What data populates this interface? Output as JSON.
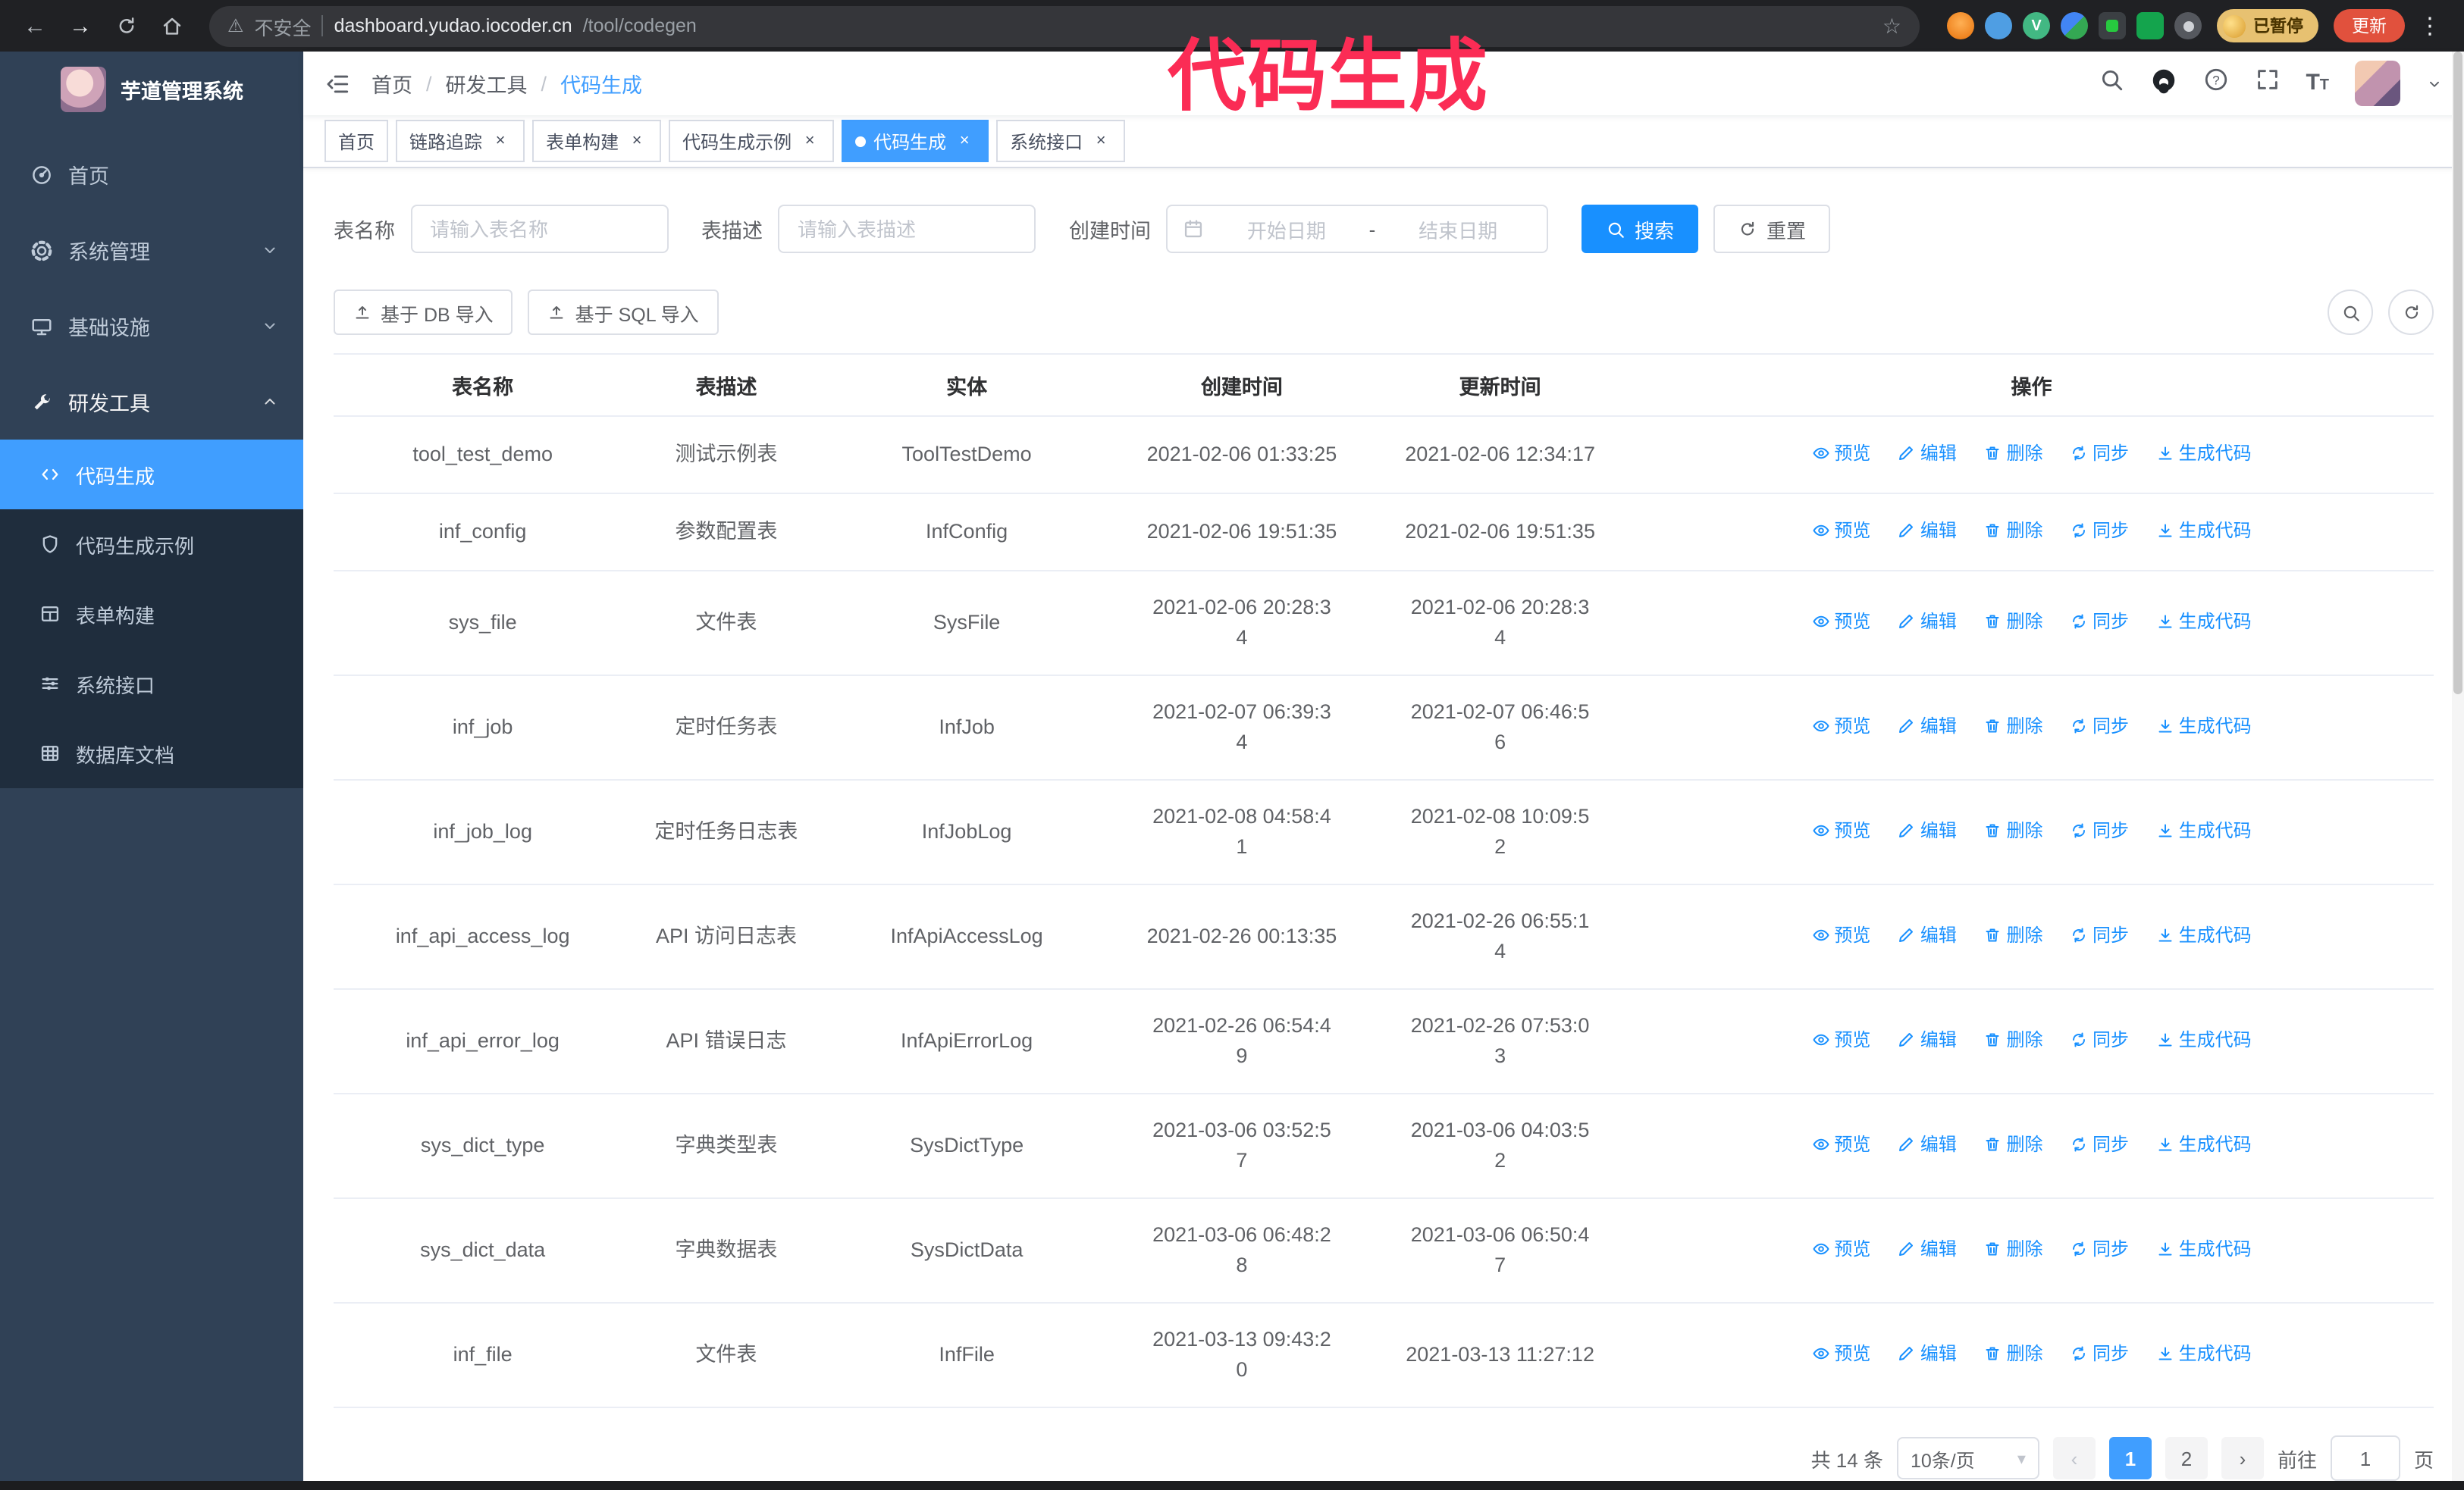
{
  "colors": {
    "accent": "#1890ff",
    "menu_active": "#409eff",
    "annotation": "#fb2c55",
    "update_button": "#e1513d",
    "sidebar_bg": "#304156"
  },
  "glyphs": {
    "back": "←",
    "forward": "→",
    "warning": "⚠",
    "star": "☆",
    "kebab": "⋮",
    "close": "×",
    "slash": "/",
    "question": "?",
    "font_size": "T",
    "prev": "‹",
    "next": "›",
    "caret": "▾",
    "range_separator": "-"
  },
  "annotation": {
    "text": "代码生成"
  },
  "browser": {
    "security_label": "不安全",
    "url_host": "dashboard.yudao.iocoder.cn",
    "url_path": "/tool/codegen",
    "paused_badge": "已暂停",
    "update_button": "更新"
  },
  "sidebar": {
    "logo_title": "芋道管理系统",
    "items": [
      {
        "label": "首页"
      },
      {
        "label": "系统管理"
      },
      {
        "label": "基础设施"
      },
      {
        "label": "研发工具"
      }
    ],
    "subitems": [
      {
        "label": "代码生成"
      },
      {
        "label": "代码生成示例"
      },
      {
        "label": "表单构建"
      },
      {
        "label": "系统接口"
      },
      {
        "label": "数据库文档"
      }
    ]
  },
  "breadcrumb": [
    "首页",
    "研发工具",
    "代码生成"
  ],
  "tabs": [
    {
      "label": "首页"
    },
    {
      "label": "链路追踪"
    },
    {
      "label": "表单构建"
    },
    {
      "label": "代码生成示例"
    },
    {
      "label": "代码生成"
    },
    {
      "label": "系统接口"
    }
  ],
  "filters": {
    "name_label": "表名称",
    "name_placeholder": "请输入表名称",
    "desc_label": "表描述",
    "desc_placeholder": "请输入表描述",
    "time_label": "创建时间",
    "start_placeholder": "开始日期",
    "end_placeholder": "结束日期",
    "search": "搜索",
    "reset": "重置"
  },
  "toolbar": {
    "import_db": "基于 DB 导入",
    "import_sql": "基于 SQL 导入"
  },
  "table": {
    "columns": [
      "表名称",
      "表描述",
      "实体",
      "创建时间",
      "更新时间",
      "操作"
    ],
    "actions": [
      "预览",
      "编辑",
      "删除",
      "同步",
      "生成代码"
    ],
    "rows": [
      {
        "name": "tool_test_demo",
        "desc": "测试示例表",
        "entity": "ToolTestDemo",
        "created": "2021-02-06 01:33:25",
        "updated": "2021-02-06 12:34:17"
      },
      {
        "name": "inf_config",
        "desc": "参数配置表",
        "entity": "InfConfig",
        "created": "2021-02-06 19:51:35",
        "updated": "2021-02-06 19:51:35"
      },
      {
        "name": "sys_file",
        "desc": "文件表",
        "entity": "SysFile",
        "created": "2021-02-06 20:28:3\n4",
        "updated": "2021-02-06 20:28:3\n4"
      },
      {
        "name": "inf_job",
        "desc": "定时任务表",
        "entity": "InfJob",
        "created": "2021-02-07 06:39:3\n4",
        "updated": "2021-02-07 06:46:5\n6"
      },
      {
        "name": "inf_job_log",
        "desc": "定时任务日志表",
        "entity": "InfJobLog",
        "created": "2021-02-08 04:58:4\n1",
        "updated": "2021-02-08 10:09:5\n2"
      },
      {
        "name": "inf_api_access_log",
        "desc": "API 访问日志表",
        "entity": "InfApiAccessLog",
        "created": "2021-02-26 00:13:35",
        "updated": "2021-02-26 06:55:1\n4"
      },
      {
        "name": "inf_api_error_log",
        "desc": "API 错误日志",
        "entity": "InfApiErrorLog",
        "created": "2021-02-26 06:54:4\n9",
        "updated": "2021-02-26 07:53:0\n3"
      },
      {
        "name": "sys_dict_type",
        "desc": "字典类型表",
        "entity": "SysDictType",
        "created": "2021-03-06 03:52:5\n7",
        "updated": "2021-03-06 04:03:5\n2"
      },
      {
        "name": "sys_dict_data",
        "desc": "字典数据表",
        "entity": "SysDictData",
        "created": "2021-03-06 06:48:2\n8",
        "updated": "2021-03-06 06:50:4\n7"
      },
      {
        "name": "inf_file",
        "desc": "文件表",
        "entity": "InfFile",
        "created": "2021-03-13 09:43:2\n0",
        "updated": "2021-03-13 11:27:12"
      }
    ]
  },
  "pagination": {
    "total": "共 14 条",
    "page_size": "10条/页",
    "page_1": "1",
    "page_2": "2",
    "goto_label": "前往",
    "goto_value": "1",
    "goto_suffix": "页"
  }
}
